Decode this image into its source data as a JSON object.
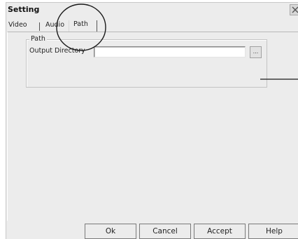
{
  "window": {
    "title": "Setting"
  },
  "tabs": [
    {
      "label": "Video"
    },
    {
      "label": "Audio"
    },
    {
      "label": "Path",
      "selected": true
    }
  ],
  "path_group": {
    "legend": "Path",
    "output_label": "Output Directory",
    "output_value": "",
    "browse_label": "..."
  },
  "buttons": {
    "ok": "Ok",
    "cancel": "Cancel",
    "accept": "Accept",
    "help": "Help"
  },
  "icons": {
    "close": "close-icon"
  }
}
